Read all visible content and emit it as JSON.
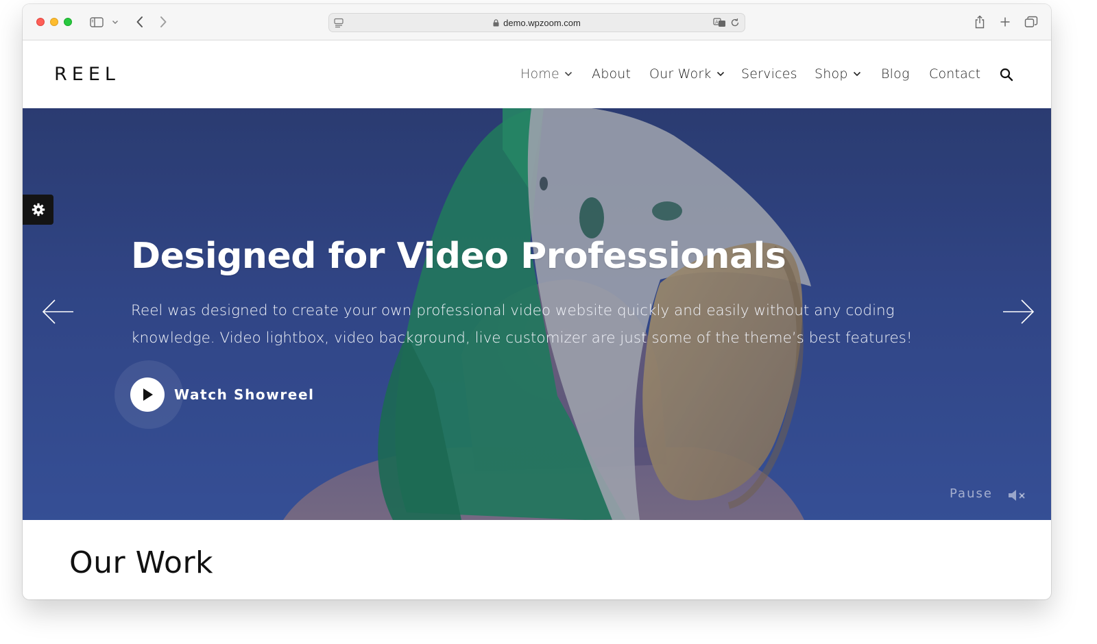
{
  "browser": {
    "url": "demo.wpzoom.com",
    "icons": [
      "sidebar-icon",
      "chevron-down-icon",
      "back-arrow-icon",
      "forward-arrow-icon",
      "page-icon",
      "lock-icon",
      "translate-icon",
      "reload-icon",
      "share-icon",
      "plus-icon",
      "tabs-icon"
    ]
  },
  "site": {
    "logo": "REEL",
    "menu": [
      {
        "label": "Home",
        "has_dropdown": true
      },
      {
        "label": "About",
        "has_dropdown": false
      },
      {
        "label": "Our Work",
        "has_dropdown": true
      },
      {
        "label": "Services",
        "has_dropdown": false
      },
      {
        "label": "Shop",
        "has_dropdown": true
      },
      {
        "label": "Blog",
        "has_dropdown": false
      },
      {
        "label": "Contact",
        "has_dropdown": false
      }
    ]
  },
  "hero": {
    "title": "Designed for Video Professionals",
    "description": "Reel was designed to create your own professional video website quickly and easily without any coding knowledge. Video lightbox, video background, live customizer are just some of the theme’s best features!",
    "cta_label": "Watch Showreel",
    "pause_label": "Pause"
  },
  "sections": {
    "our_work_title": "Our Work"
  },
  "colors": {
    "hero_top": "#2b3a6e",
    "hero_bottom": "#3a55a0",
    "hair_green": "#1f8f4f",
    "text_dark": "#111111"
  }
}
